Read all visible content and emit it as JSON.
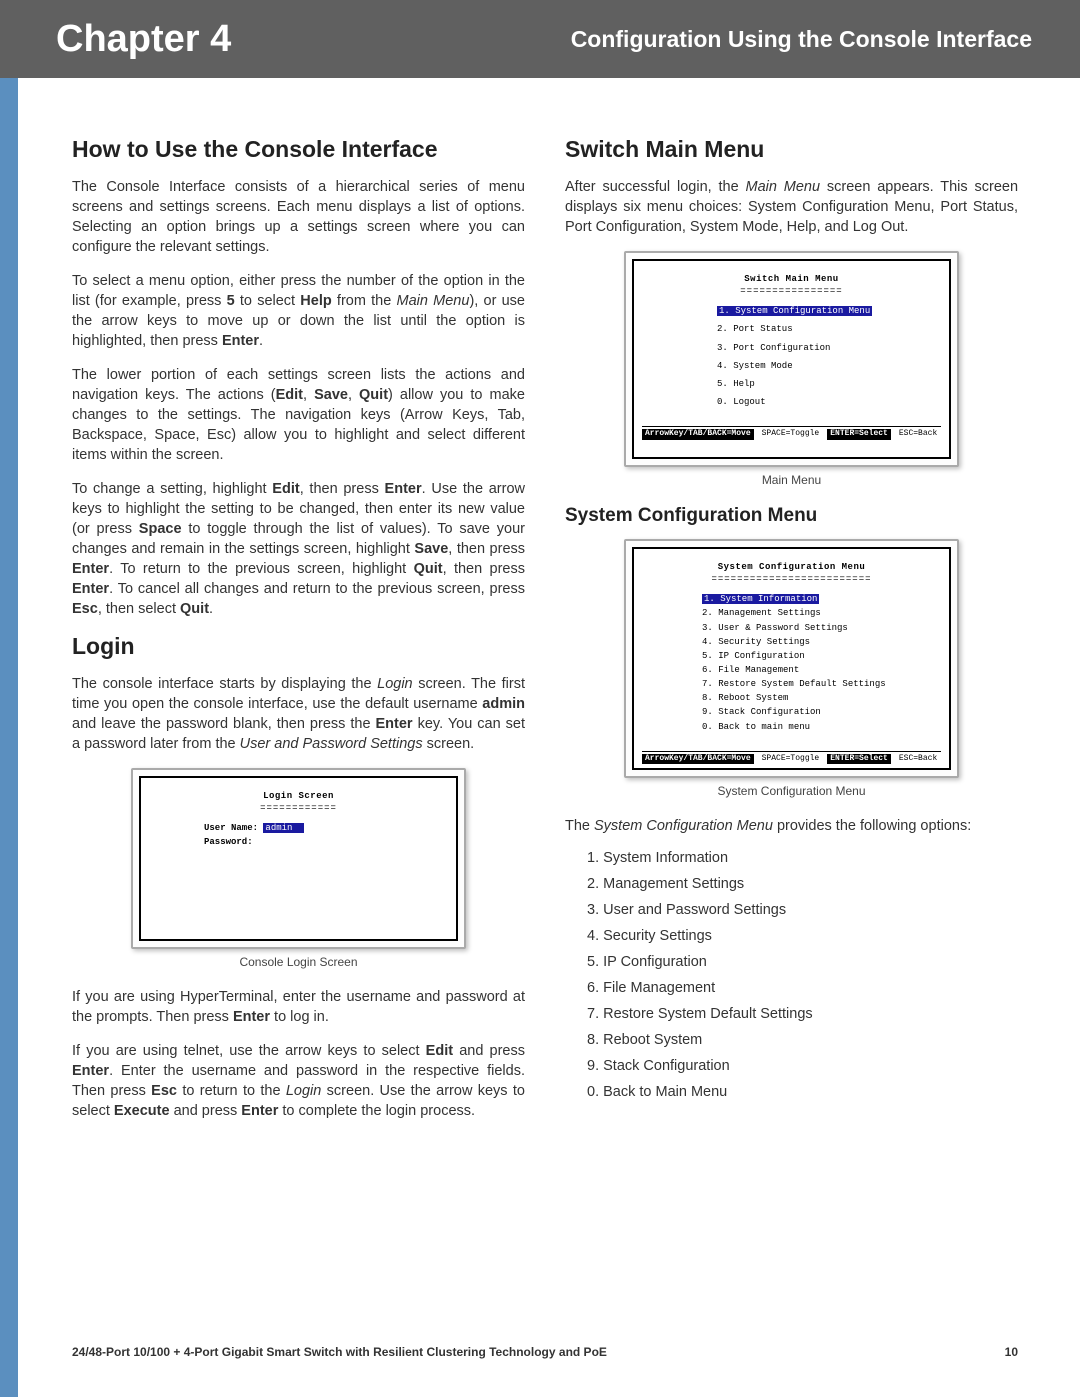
{
  "header": {
    "chapter": "Chapter 4",
    "title_right": "Configuration Using the Console Interface"
  },
  "left": {
    "h_howto": "How to Use the Console Interface",
    "p1a": "The Console Interface consists of a hierarchical series of menu screens and settings screens. Each menu displays a list of options. Selecting an option brings up a settings screen where you can configure the relevant settings.",
    "p2_pre": "To select a menu option, either press the number of the option in the list (for example, press ",
    "p2_b1": "5",
    "p2_mid1": " to select ",
    "p2_b2": "Help",
    "p2_mid2": " from the ",
    "p2_i1": "Main Menu",
    "p2_mid3": "), or use the arrow keys to move up or down the list until the option is highlighted, then press ",
    "p2_b3": "Enter",
    "p2_end": ".",
    "p3_pre": "The lower portion of each settings screen lists the actions and navigation keys. The actions (",
    "p3_b1": "Edit",
    "p3_c1": ", ",
    "p3_b2": "Save",
    "p3_c2": ", ",
    "p3_b3": "Quit",
    "p3_mid": ") allow you to make changes to the settings. The navigation keys (Arrow Keys, Tab, Backspace, Space, Esc) allow you to highlight and select different items within the screen.",
    "p4_pre": "To change a setting, highlight ",
    "p4_b1": "Edit",
    "p4_m1": ", then press ",
    "p4_b2": "Enter",
    "p4_m2": ". Use the arrow keys to highlight the setting to be changed, then enter its new value (or press ",
    "p4_b3": "Space",
    "p4_m3": " to toggle through the list of values). To save your changes and remain in the settings screen, highlight ",
    "p4_b4": "Save",
    "p4_m4": ", then press ",
    "p4_b5": "Enter",
    "p4_m5": ". To return to the previous screen, highlight ",
    "p4_b6": "Quit",
    "p4_m6": ", then press ",
    "p4_b7": "Enter",
    "p4_m7": ". To cancel all changes and return to the previous screen, press ",
    "p4_b8": "Esc",
    "p4_m8": ", then select ",
    "p4_b9": "Quit",
    "p4_end": ".",
    "h_login": "Login",
    "p5_pre": "The console interface starts by displaying the ",
    "p5_i1": "Login",
    "p5_m1": " screen. The first time you open the console interface, use the default username ",
    "p5_b1": "admin",
    "p5_m2": " and leave the password blank, then press the ",
    "p5_b2": "Enter",
    "p5_m3": " key. You can set a password later from the ",
    "p5_i2": "User and Password Settings",
    "p5_end": " screen.",
    "login_term": {
      "title": "Login Screen",
      "under": "============",
      "user_label": "User Name:",
      "user_val": "admin",
      "pass_label": "Password:"
    },
    "cap_login": "Console Login Screen",
    "p6_pre": "If you are using HyperTerminal, enter the username and password at the prompts. Then press ",
    "p6_b1": "Enter",
    "p6_end": " to log in.",
    "p7_pre": "If you are using telnet, use the arrow keys to select ",
    "p7_b1": "Edit",
    "p7_m1": " and press ",
    "p7_b2": "Enter",
    "p7_m2": ". Enter the username and password in the respective fields. Then press ",
    "p7_b3": "Esc",
    "p7_m3": " to return to the ",
    "p7_i1": "Login",
    "p7_m4": " screen. Use the arrow keys to select ",
    "p7_b4": "Execute",
    "p7_m5": " and press ",
    "p7_b5": "Enter",
    "p7_end": " to complete the login process."
  },
  "right": {
    "h_switch": "Switch Main Menu",
    "p1_pre": "After successful login, the ",
    "p1_i1": "Main Menu",
    "p1_end": " screen appears. This screen displays six menu choices: System Configuration Menu, Port Status, Port Configuration, System Mode, Help, and Log Out.",
    "main_term": {
      "title": "Switch Main Menu",
      "under": "================",
      "items": [
        "1. System Configuration Menu",
        "2. Port Status",
        "3. Port Configuration",
        "4. System Mode",
        "5. Help",
        "0. Logout"
      ],
      "footer_a": "ArrowKey/TAB/BACK=Move",
      "footer_b": "SPACE=Toggle",
      "footer_c": "ENTER=Select",
      "footer_d": "ESC=Back"
    },
    "cap_main": "Main Menu",
    "h_sys": "System Configuration Menu",
    "sys_term": {
      "title": "System Configuration Menu",
      "under": "=========================",
      "items": [
        "1. System Information",
        "2. Management Settings",
        "3. User & Password Settings",
        "4. Security Settings",
        "5. IP Configuration",
        "6. File Management",
        "7. Restore System Default Settings",
        "8. Reboot System",
        "9. Stack Configuration",
        "0. Back to main menu"
      ],
      "footer_a": "ArrowKey/TAB/BACK=Move",
      "footer_b": "SPACE=Toggle",
      "footer_c": "ENTER=Select",
      "footer_d": "ESC=Back"
    },
    "cap_sys": "System Configuration Menu",
    "p2_pre": "The ",
    "p2_i1": "System Configuration Menu",
    "p2_end": " provides the following options:",
    "options": [
      "1.  System Information",
      "2.  Management Settings",
      "3.  User and Password Settings",
      "4.  Security Settings",
      "5.  IP Configuration",
      "6.  File Management",
      "7.  Restore System Default Settings",
      "8.  Reboot System",
      "9.  Stack Configuration",
      "0.  Back to Main Menu"
    ]
  },
  "footer": {
    "left": "24/48-Port 10/100 + 4-Port Gigabit Smart Switch with Resilient Clustering Technology and PoE",
    "right": "10"
  }
}
